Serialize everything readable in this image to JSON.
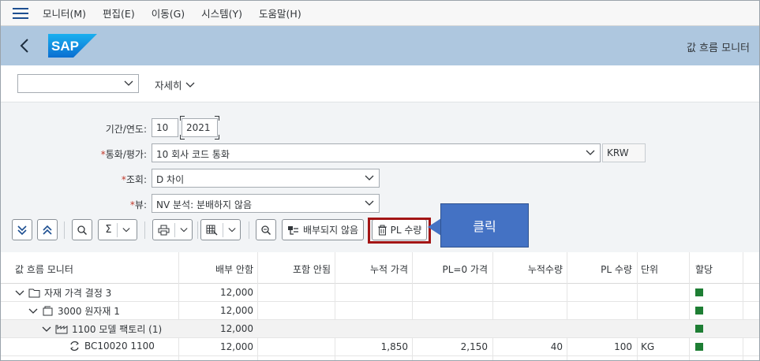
{
  "menu": {
    "items": [
      "모니터(M)",
      "편집(E)",
      "이동(G)",
      "시스템(Y)",
      "도움말(H)"
    ]
  },
  "header": {
    "logo_text": "SAP",
    "title": "값 흐름 모니터"
  },
  "variant": {
    "value": "",
    "details_label": "자세히"
  },
  "form": {
    "period_label": "기간/연도:",
    "period_value": "10",
    "year_value": "2021",
    "currency_label": "통화/평가:",
    "currency_value": "10 회사 코드 통화",
    "currency_code": "KRW",
    "view_label": "조회:",
    "view_value": "D 차이",
    "layout_label": "뷰:",
    "layout_value": "NV 분석: 분배하지 않음"
  },
  "toolbar": {
    "expand_all": "expand-all",
    "collapse_all": "collapse-all",
    "unallocated_label": "배부되지 않음",
    "pl_qty_label": "PL 수량"
  },
  "callout": {
    "text": "클릭"
  },
  "table": {
    "headers": [
      "값 흐름 모니터",
      "배부 안함",
      "포함 안됨",
      "누적 가격",
      "PL=0 가격",
      "누적수량",
      "PL 수량",
      "단위",
      "할당"
    ],
    "rows": [
      {
        "name": "자재 가격 결정 3",
        "unalloc": "12,000",
        "excl": "",
        "cum_price": "",
        "pl0_price": "",
        "cum_qty": "",
        "pl_qty": "",
        "unit": "",
        "status_color": "#1e7e34"
      },
      {
        "name": "3000 원자재 1",
        "unalloc": "12,000",
        "excl": "",
        "cum_price": "",
        "pl0_price": "",
        "cum_qty": "",
        "pl_qty": "",
        "unit": "",
        "status_color": "#1e7e34"
      },
      {
        "name": "1100 모델 팩토리 (1)",
        "unalloc": "12,000",
        "excl": "",
        "cum_price": "",
        "pl0_price": "",
        "cum_qty": "",
        "pl_qty": "",
        "unit": "",
        "status_color": "#1e7e34"
      },
      {
        "name": "BC10020 1100",
        "unalloc": "12,000",
        "excl": "",
        "cum_price": "1,850",
        "pl0_price": "2,150",
        "cum_qty": "40",
        "pl_qty": "100",
        "unit": "KG",
        "status_color": "#1e7e34"
      }
    ]
  },
  "colors": {
    "header_bg": "#aec7df",
    "accent": "#1d4f91",
    "highlight_border": "#a31515",
    "callout_bg": "#4472c4",
    "status_green": "#1e7e34"
  }
}
